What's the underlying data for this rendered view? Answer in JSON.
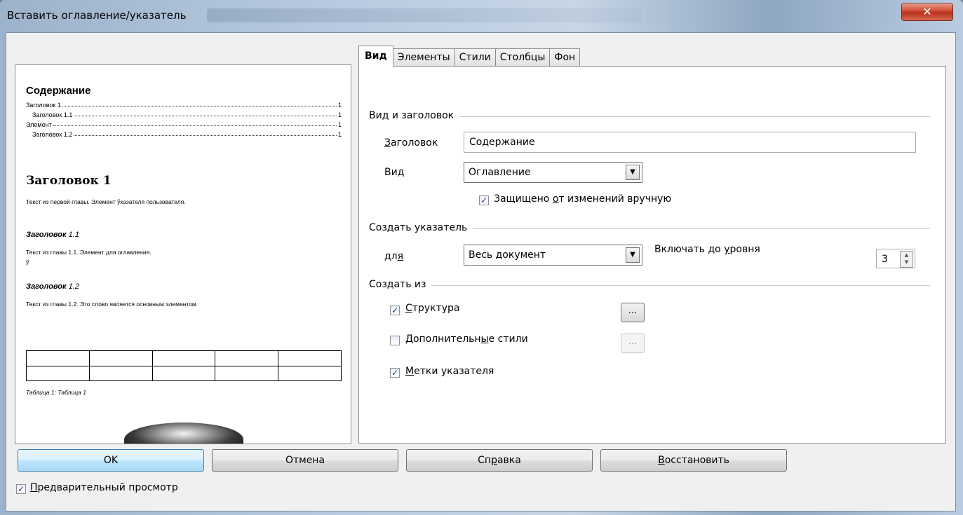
{
  "window": {
    "title": "Вставить оглавление/указатель",
    "close_glyph": "✕"
  },
  "preview": {
    "toc_title": "Содержание",
    "toc_entries": [
      {
        "text": "Заголовок 1",
        "page": "1"
      },
      {
        "text": "Заголовок 1.1",
        "page": "1"
      },
      {
        "text": "Элемент",
        "page": "1"
      },
      {
        "text": "Заголовок 1.2",
        "page": "1"
      }
    ],
    "heading1": "Заголовок 1",
    "text1": "Текст из первой главы. Элемент ўказателя пользователя.",
    "heading11_bold": "Заголовок",
    "heading11_num": " 1.1",
    "text11": "Текст из главы 1.1. Элемент для оглавления.",
    "text11_extra": "ў",
    "heading12_bold": "Заголовок",
    "heading12_num": " 1.2",
    "text12": "Текст из главы 1.2. Это слово является основным элементом.",
    "table_caption": "Таблица 1: Таблица 1"
  },
  "tabs": [
    {
      "label": "Вид",
      "active": true
    },
    {
      "label": "Элементы",
      "active": false
    },
    {
      "label": "Стили",
      "active": false
    },
    {
      "label": "Столбцы",
      "active": false
    },
    {
      "label": "Фон",
      "active": false
    }
  ],
  "type_section": {
    "header": "Вид и заголовок",
    "title_label_u": "З",
    "title_label_rest": "аголовок",
    "title_value": "Содержание",
    "type_label_a": "Ви",
    "type_label_u": "д",
    "type_value": "Оглавление",
    "protected_a": "Защищено ",
    "protected_u": "о",
    "protected_b": "т изменений вручную",
    "protected_checked": true
  },
  "index_section": {
    "header": "Создать указатель",
    "for_label_a": "дл",
    "for_label_u": "я",
    "for_value": "Весь документ",
    "level_label_a": "Включать до ",
    "level_label_u": "у",
    "level_label_b": "ровня",
    "level_value": "3"
  },
  "from_section": {
    "header": "Создать из",
    "structure_u": "С",
    "structure_rest": "труктура",
    "structure_checked": true,
    "additional_a": "Дополнительн",
    "additional_u": "ы",
    "additional_b": "е стили",
    "additional_checked": false,
    "marks_u": "М",
    "marks_rest": "етки указателя",
    "marks_checked": true,
    "ellipsis": "..."
  },
  "buttons": {
    "ok": "OK",
    "cancel": "Отмена",
    "help_a": "Сп",
    "help_u": "р",
    "help_b": "авка",
    "reset_u": "В",
    "reset_rest": "осстановить"
  },
  "preview_toggle": {
    "label_u": "П",
    "label_rest": "редварительный просмотр",
    "checked": true
  },
  "check_glyph": "✓",
  "colors": {
    "accent": "#3c7fb1",
    "close": "#c7432c",
    "check": "#1e3f94"
  }
}
